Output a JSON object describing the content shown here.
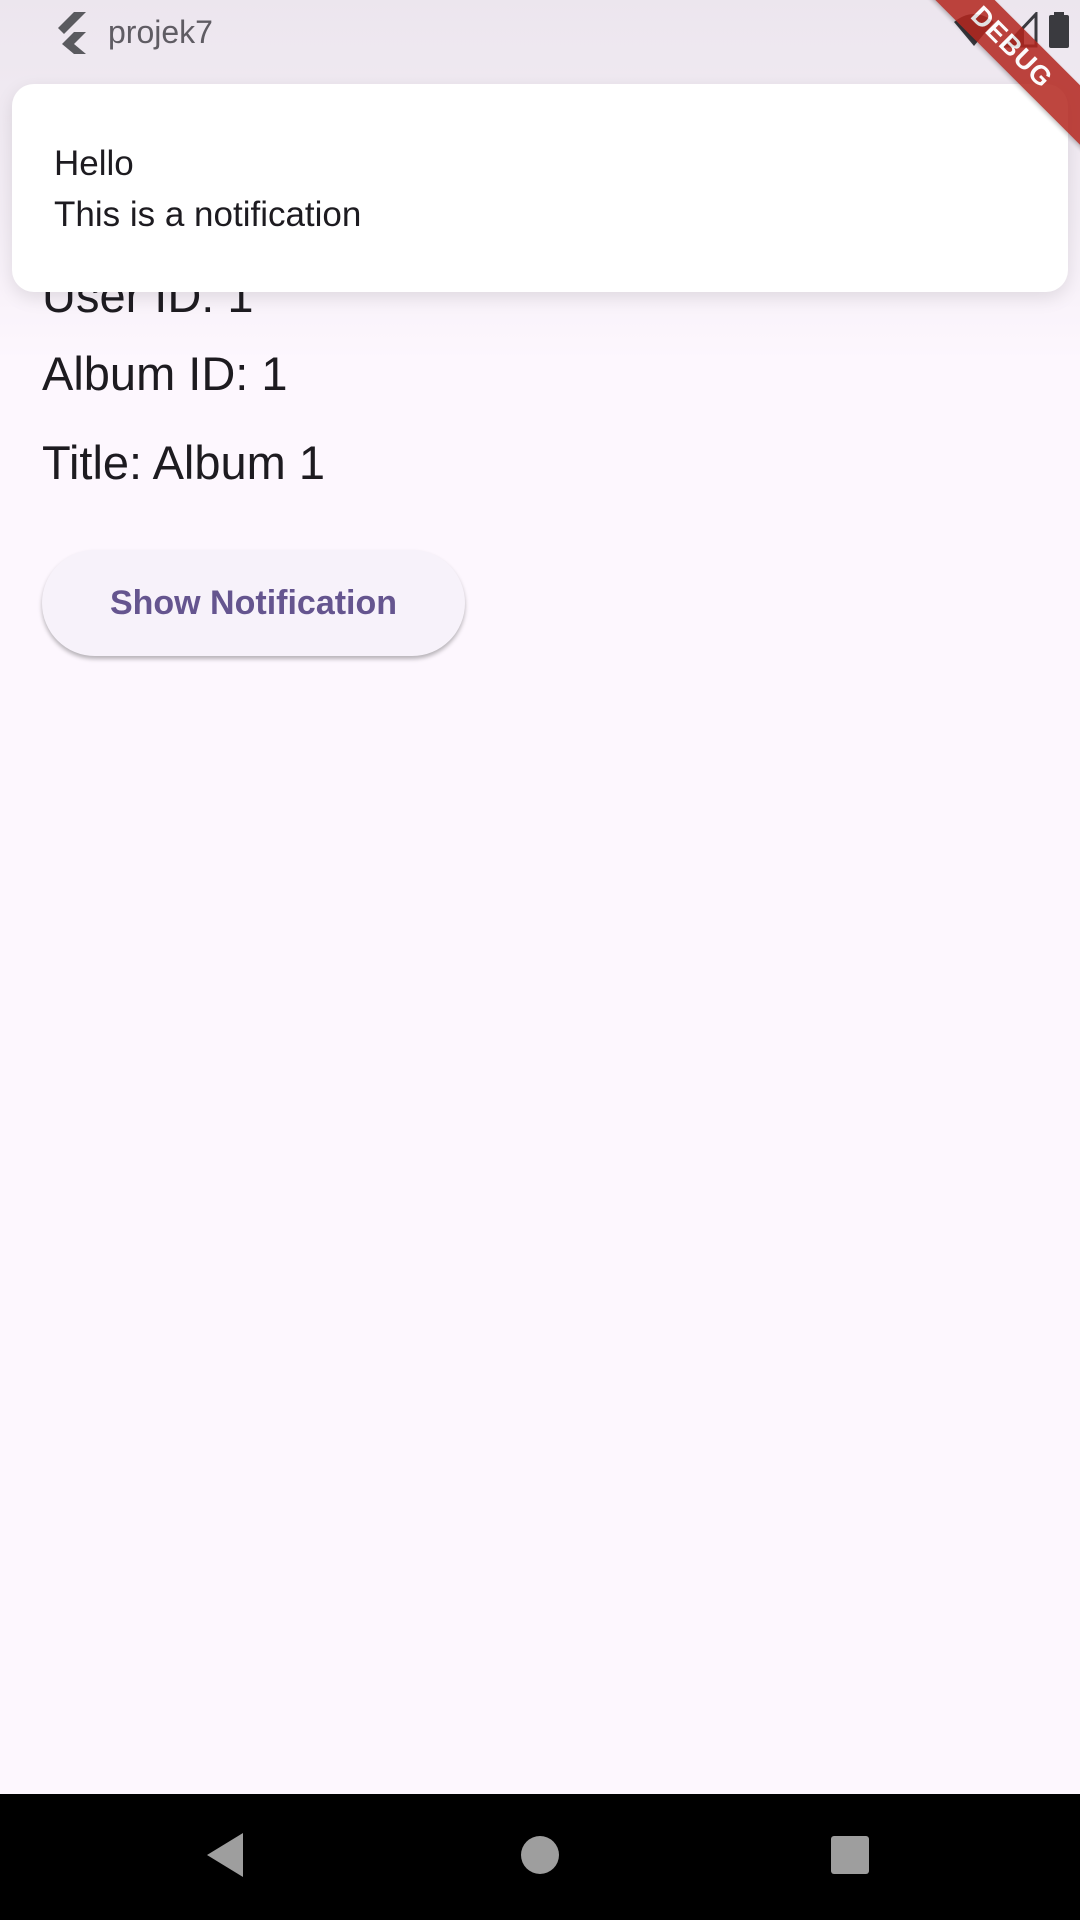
{
  "status_bar": {
    "app_title": "projek7",
    "icons": [
      "flutter-logo-icon",
      "wifi-icon",
      "signal-icon",
      "battery-icon"
    ]
  },
  "debug_banner": {
    "label": "DEBUG",
    "color": "#B3261E"
  },
  "content": {
    "user_id": "User ID: 1",
    "album_id": "Album ID: 1",
    "title": "Title: Album 1",
    "button_label": "Show Notification"
  },
  "notification": {
    "title": "Hello",
    "body": "This is a notification"
  },
  "nav_bar": {
    "buttons": [
      "back-icon",
      "home-icon",
      "recents-icon"
    ]
  },
  "colors": {
    "background": "#FDF7FE",
    "accent": "#65558F",
    "button_bg": "#F7F2FA",
    "text": "#1D1B20"
  }
}
